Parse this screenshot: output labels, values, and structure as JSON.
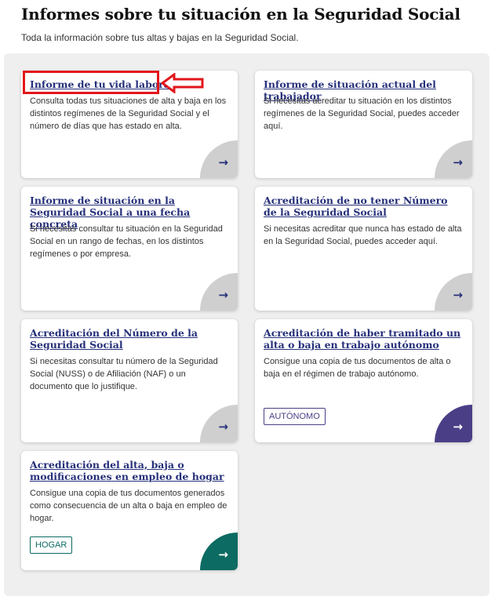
{
  "page": {
    "title": "Informes sobre tu situación en la Seguridad Social",
    "subtitle": "Toda la información sobre tus altas y bajas en la Seguridad Social."
  },
  "cards": [
    {
      "title": "Informe de tu vida laboral",
      "description": "Consulta todas tus situaciones de alta y baja en los distintos regímenes de la Seguridad Social y el número de días que has estado en alta.",
      "arrow": "→",
      "highlighted": true
    },
    {
      "title": "Informe de situación actual del trabajador",
      "description": "Si necesitas acreditar tu situación en los distintos regímenes de la Seguridad Social, puedes acceder aquí.",
      "arrow": "→"
    },
    {
      "title": "Informe de situación en la Seguridad Social a una fecha concreta",
      "description": "Si necesitas consultar tu situación en la Seguridad Social en un rango de fechas, en los distintos regímenes o por empresa.",
      "arrow": "→"
    },
    {
      "title": "Acreditación de no tener Número de la Seguridad Social",
      "description": "Si necesitas acreditar que nunca has estado de alta en la Seguridad Social, puedes acceder aquí.",
      "arrow": "→"
    },
    {
      "title": "Acreditación del Número de la Seguridad Social",
      "description": "Si necesitas consultar tu número de la Seguridad Social (NUSS) o de Afiliación (NAF) o un documento que lo justifique.",
      "arrow": "→"
    },
    {
      "title": "Acreditación de haber tramitado un alta o baja en trabajo autónomo",
      "description": "Consigue una copia de tus documentos de alta o baja en el régimen de trabajo autónomo.",
      "tag": "AUTÓNOMO",
      "arrow": "→",
      "accent": "#4a3f87"
    },
    {
      "title": "Acreditación del alta, baja o modificaciones en empleo de hogar",
      "description": "Consigue una copia de tus documentos generados como consecuencia de un alta o baja en empleo de hogar.",
      "tag": "HOGAR",
      "arrow": "→",
      "accent": "#0c6b62"
    }
  ],
  "colors": {
    "link": "#26307a",
    "highlight": "#e2161b",
    "panel_bg": "#efefef",
    "corner_default": "#cfcfcf"
  },
  "icons": {
    "card_arrow": "arrow-right-icon",
    "annotation": "red-outline-arrow-left-icon"
  }
}
